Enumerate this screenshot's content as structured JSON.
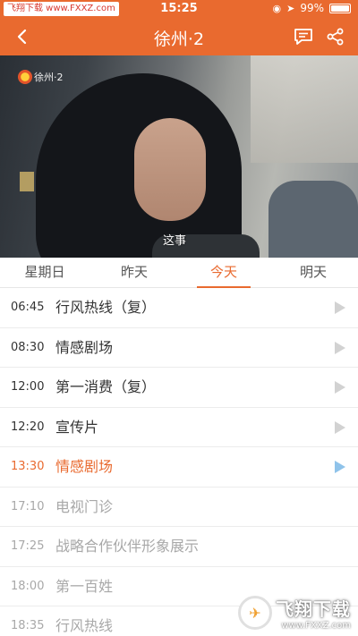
{
  "status_bar": {
    "carrier": "飞翔下载 www.FXXZ.com",
    "time": "15:25",
    "battery": "99%",
    "battery_level": 0.99
  },
  "nav": {
    "title": "徐州·2",
    "back_icon": "chevron-left-icon",
    "message_icon": "chat-bubble-icon",
    "share_icon": "share-icon"
  },
  "video": {
    "channel_logo_text": "徐州·2",
    "subtitle": "这事"
  },
  "tabs": [
    {
      "label": "星期日",
      "active": false
    },
    {
      "label": "昨天",
      "active": false
    },
    {
      "label": "今天",
      "active": true
    },
    {
      "label": "明天",
      "active": false
    }
  ],
  "schedule": [
    {
      "time": "06:45",
      "title": "行风热线（复）",
      "state": "past"
    },
    {
      "time": "08:30",
      "title": "情感剧场",
      "state": "past"
    },
    {
      "time": "12:00",
      "title": "第一消费（复）",
      "state": "past"
    },
    {
      "time": "12:20",
      "title": "宣传片",
      "state": "past"
    },
    {
      "time": "13:30",
      "title": "情感剧场",
      "state": "current"
    },
    {
      "time": "17:10",
      "title": "电视门诊",
      "state": "future"
    },
    {
      "time": "17:25",
      "title": "战略合作伙伴形象展示",
      "state": "future"
    },
    {
      "time": "18:00",
      "title": "第一百姓",
      "state": "future"
    },
    {
      "time": "18:35",
      "title": "行风热线",
      "state": "future"
    }
  ],
  "watermark": {
    "brand": "飞翔下载",
    "url": "www.FXXZ.com"
  },
  "colors": {
    "accent": "#e96a2f",
    "current_play": "#8fc3ea",
    "future_text": "#a8a8a8"
  }
}
